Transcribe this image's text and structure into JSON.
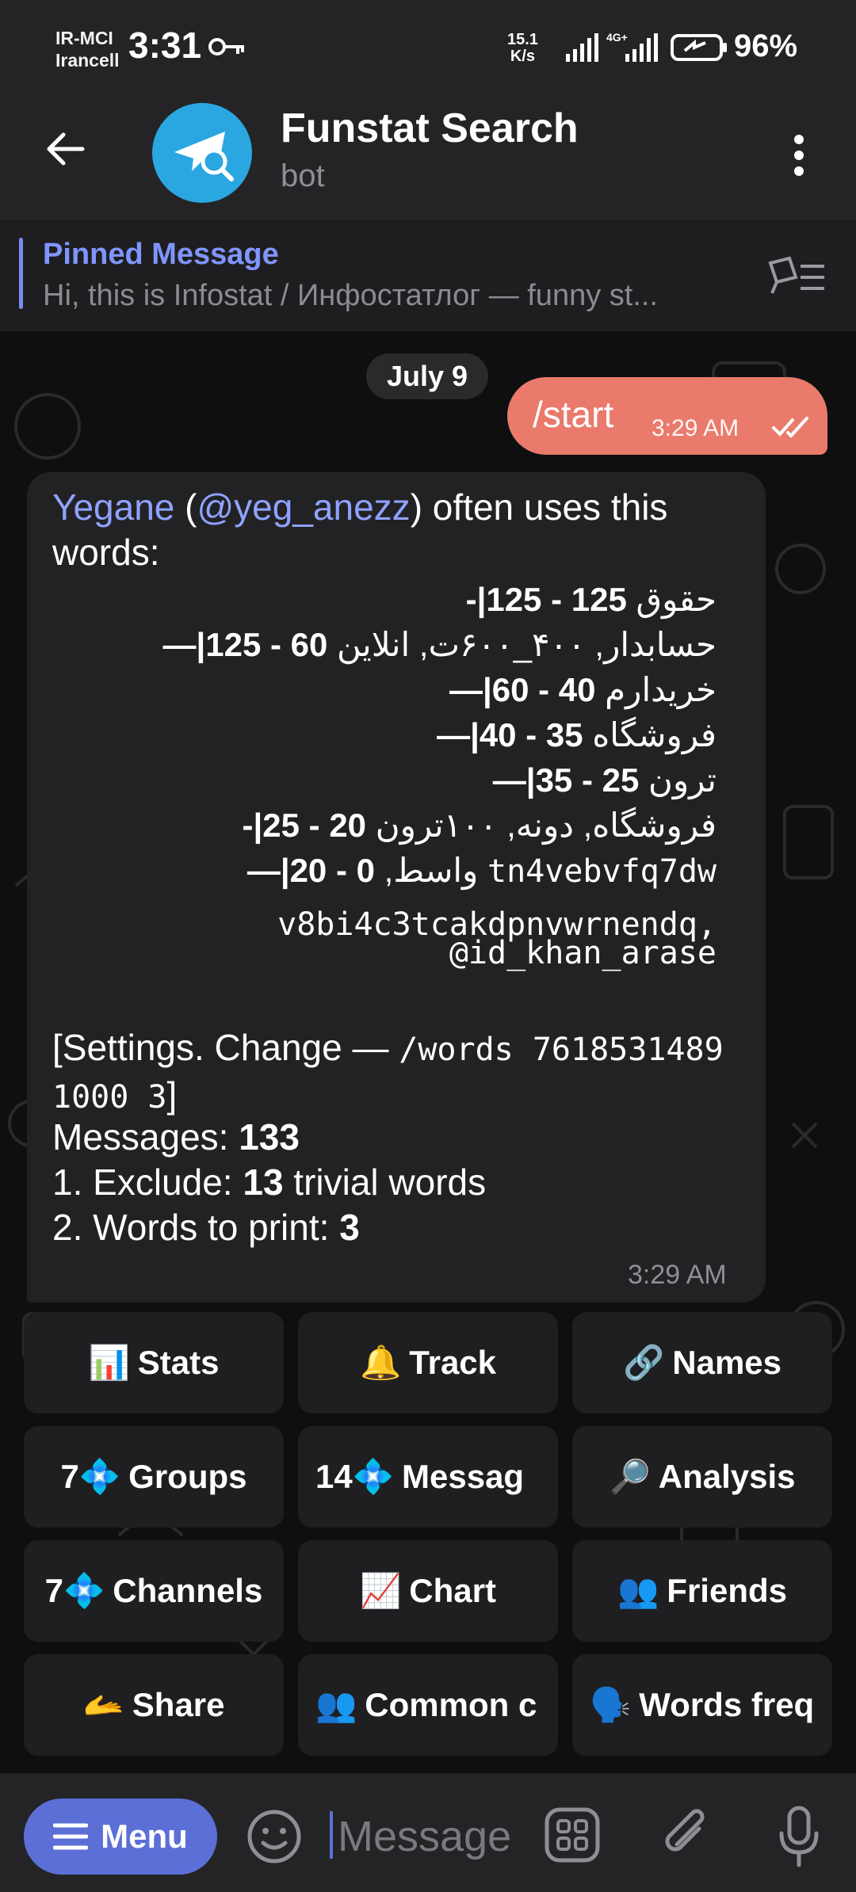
{
  "status_bar": {
    "carrier_line1": "IR-MCI",
    "carrier_line2": "Irancell",
    "time": "3:31",
    "net_speed_value": "15.1",
    "net_speed_unit": "K/s",
    "network_type": "4G+",
    "battery": "96%"
  },
  "header": {
    "title": "Funstat Search",
    "subtitle": "bot"
  },
  "pinned": {
    "title": "Pinned Message",
    "text": "Hi, this is Infostat / Инфостатлог — funny st..."
  },
  "chat": {
    "date_label": "July 9",
    "outgoing": {
      "text": "/start",
      "time": "3:29 AM"
    },
    "incoming": {
      "name": "Yegane",
      "username": "@yeg_anezz",
      "intro_rest": " often uses this words:",
      "rows": [
        {
          "prefix": "|-",
          "range": "125 - 125",
          "words": "حقوق"
        },
        {
          "prefix": "|—",
          "range": "60 - 125",
          "words": "حسابدار, ۴۰۰_۶۰۰ت, انلاین"
        },
        {
          "prefix": "|—",
          "range": "40 - 60",
          "words": "خریدارم"
        },
        {
          "prefix": "|—",
          "range": "35 - 40",
          "words": "فروشگاه"
        },
        {
          "prefix": "|—",
          "range": "25 - 35",
          "words": "ترون"
        },
        {
          "prefix": "|-",
          "range": "20 - 25",
          "words": "فروشگاه, دونه, ۱۰۰ترون"
        },
        {
          "prefix": "|—",
          "range": "0 - 20",
          "words": "واسط,"
        }
      ],
      "mono_words": [
        "tn4vebvfq7dw",
        "v8bi4c3tcakdpnvwrnendq,",
        "@id_khan_arase"
      ],
      "settings_prefix": "[Settings. Change — ",
      "settings_command": "/words 7618531489 1000 3",
      "settings_suffix": "]",
      "messages_label": "Messages: ",
      "messages_value": "133",
      "exclude_label": "1. Exclude: ",
      "exclude_value": "13",
      "exclude_suffix": " trivial words",
      "print_label": "2. Words to print: ",
      "print_value": "3",
      "time": "3:29 AM"
    }
  },
  "keyboard": {
    "buttons": [
      {
        "emoji": "📊",
        "label": "Stats"
      },
      {
        "emoji": "🔔",
        "label": "Track"
      },
      {
        "emoji": "🔗",
        "label": "Names"
      },
      {
        "emoji": "7💠",
        "label": "Groups"
      },
      {
        "emoji": "14💠",
        "label": "Messag"
      },
      {
        "emoji": "🔎",
        "label": "Analysis"
      },
      {
        "emoji": "7💠",
        "label": "Channels"
      },
      {
        "emoji": "📈",
        "label": "Chart"
      },
      {
        "emoji": "👥",
        "label": "Friends"
      },
      {
        "emoji": "🫴",
        "label": "Share"
      },
      {
        "emoji": "👥",
        "label": "Common c"
      },
      {
        "emoji": "🗣️",
        "label": "Words freq"
      }
    ]
  },
  "input_bar": {
    "menu_label": "Menu",
    "placeholder": "Message"
  },
  "colors": {
    "accent": "#5b6fd6",
    "outgoing_bubble": "#ea7a6b",
    "link": "#8fa2ff",
    "avatar": "#2aa7e0"
  }
}
